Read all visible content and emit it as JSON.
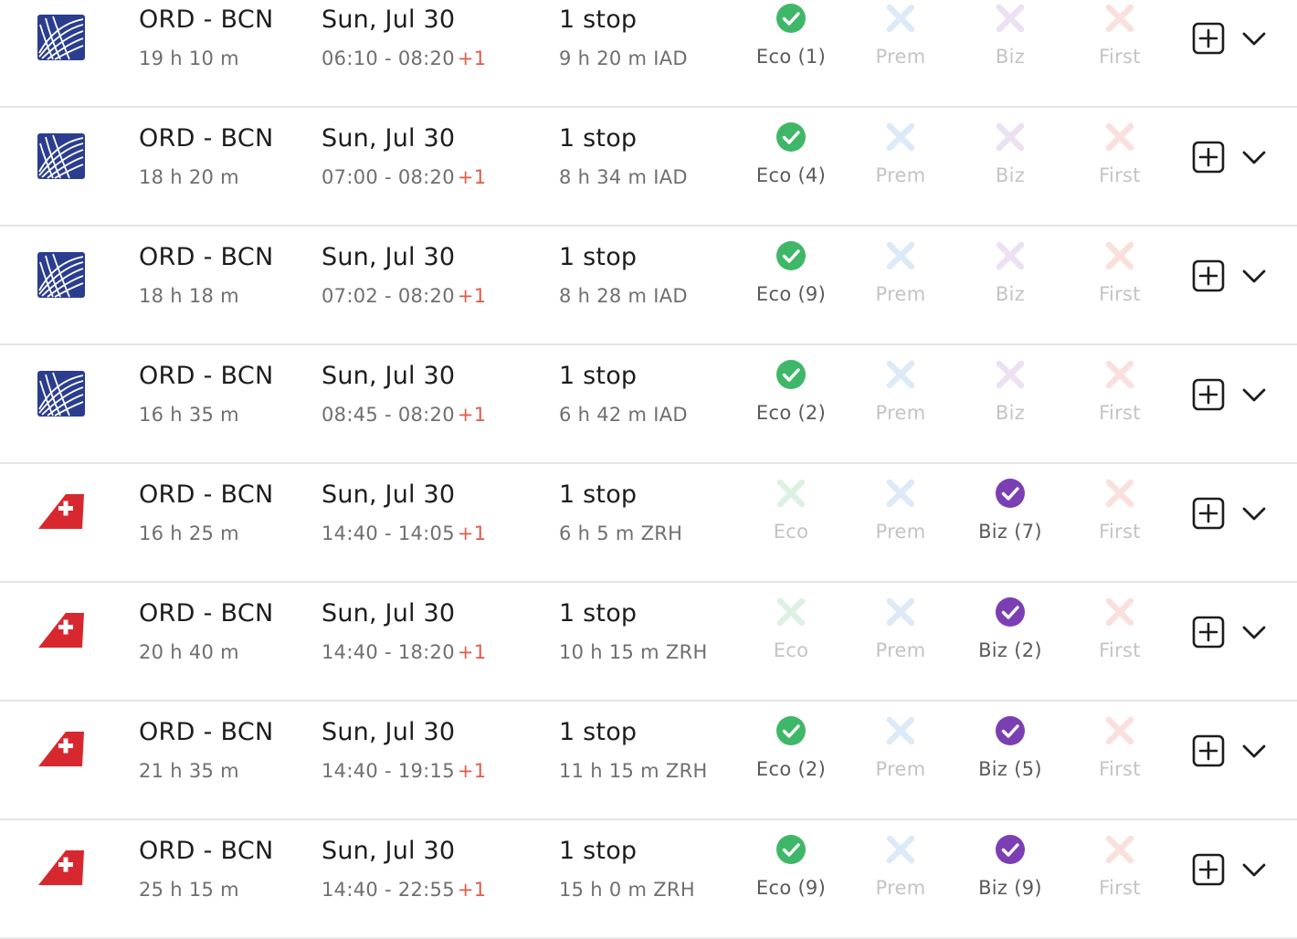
{
  "flights": [
    {
      "airline": "united",
      "route": "ORD - BCN",
      "duration": "19 h 10 m",
      "date": "Sun, Jul 30",
      "times": "06:10 - 08:20",
      "plus_day": "+1",
      "stops": "1 stop",
      "layover": "9 h 20 m  IAD",
      "cabins": [
        {
          "label": "Eco (1)",
          "available": true
        },
        {
          "label": "Prem",
          "available": false
        },
        {
          "label": "Biz",
          "available": false
        },
        {
          "label": "First",
          "available": false
        }
      ]
    },
    {
      "airline": "united",
      "route": "ORD - BCN",
      "duration": "18 h 20 m",
      "date": "Sun, Jul 30",
      "times": "07:00 - 08:20",
      "plus_day": "+1",
      "stops": "1 stop",
      "layover": "8 h 34 m  IAD",
      "cabins": [
        {
          "label": "Eco (4)",
          "available": true
        },
        {
          "label": "Prem",
          "available": false
        },
        {
          "label": "Biz",
          "available": false
        },
        {
          "label": "First",
          "available": false
        }
      ]
    },
    {
      "airline": "united",
      "route": "ORD - BCN",
      "duration": "18 h 18 m",
      "date": "Sun, Jul 30",
      "times": "07:02 - 08:20",
      "plus_day": "+1",
      "stops": "1 stop",
      "layover": "8 h 28 m  IAD",
      "cabins": [
        {
          "label": "Eco (9)",
          "available": true
        },
        {
          "label": "Prem",
          "available": false
        },
        {
          "label": "Biz",
          "available": false
        },
        {
          "label": "First",
          "available": false
        }
      ]
    },
    {
      "airline": "united",
      "route": "ORD - BCN",
      "duration": "16 h 35 m",
      "date": "Sun, Jul 30",
      "times": "08:45 - 08:20",
      "plus_day": "+1",
      "stops": "1 stop",
      "layover": "6 h 42 m  IAD",
      "cabins": [
        {
          "label": "Eco (2)",
          "available": true
        },
        {
          "label": "Prem",
          "available": false
        },
        {
          "label": "Biz",
          "available": false
        },
        {
          "label": "First",
          "available": false
        }
      ]
    },
    {
      "airline": "swiss",
      "route": "ORD - BCN",
      "duration": "16 h 25 m",
      "date": "Sun, Jul 30",
      "times": "14:40 - 14:05",
      "plus_day": "+1",
      "stops": "1 stop",
      "layover": "6 h 5 m  ZRH",
      "cabins": [
        {
          "label": "Eco",
          "available": false
        },
        {
          "label": "Prem",
          "available": false
        },
        {
          "label": "Biz (7)",
          "available": true
        },
        {
          "label": "First",
          "available": false
        }
      ]
    },
    {
      "airline": "swiss",
      "route": "ORD - BCN",
      "duration": "20 h 40 m",
      "date": "Sun, Jul 30",
      "times": "14:40 - 18:20",
      "plus_day": "+1",
      "stops": "1 stop",
      "layover": "10 h 15 m  ZRH",
      "cabins": [
        {
          "label": "Eco",
          "available": false
        },
        {
          "label": "Prem",
          "available": false
        },
        {
          "label": "Biz (2)",
          "available": true
        },
        {
          "label": "First",
          "available": false
        }
      ]
    },
    {
      "airline": "swiss",
      "route": "ORD - BCN",
      "duration": "21 h 35 m",
      "date": "Sun, Jul 30",
      "times": "14:40 - 19:15",
      "plus_day": "+1",
      "stops": "1 stop",
      "layover": "11 h 15 m  ZRH",
      "cabins": [
        {
          "label": "Eco (2)",
          "available": true
        },
        {
          "label": "Prem",
          "available": false
        },
        {
          "label": "Biz (5)",
          "available": true
        },
        {
          "label": "First",
          "available": false
        }
      ]
    },
    {
      "airline": "swiss",
      "route": "ORD - BCN",
      "duration": "25 h 15 m",
      "date": "Sun, Jul 30",
      "times": "14:40 - 22:55",
      "plus_day": "+1",
      "stops": "1 stop",
      "layover": "15 h 0 m  ZRH",
      "cabins": [
        {
          "label": "Eco (9)",
          "available": true
        },
        {
          "label": "Prem",
          "available": false
        },
        {
          "label": "Biz (9)",
          "available": true
        },
        {
          "label": "First",
          "available": false
        }
      ]
    }
  ],
  "cabin_classes": [
    {
      "key": "eco",
      "available_color": "#3fb768",
      "unavailable_color": "#ddf1e3",
      "available_icon": "check-circle-icon",
      "unavailable_icon": "x-icon"
    },
    {
      "key": "prem",
      "available_color": "#4a90d9",
      "unavailable_color": "#dce9f7",
      "available_icon": "check-circle-icon",
      "unavailable_icon": "x-icon"
    },
    {
      "key": "biz",
      "available_color": "#7b3fb3",
      "unavailable_color": "#ece0f3",
      "available_icon": "check-circle-icon",
      "unavailable_icon": "x-icon"
    },
    {
      "key": "first",
      "available_color": "#e25b4b",
      "unavailable_color": "#fae0dc",
      "available_icon": "check-circle-icon",
      "unavailable_icon": "x-icon"
    }
  ],
  "airlines": {
    "united": {
      "icon": "united-globe-icon",
      "color": "#2b3d8f"
    },
    "swiss": {
      "icon": "swiss-tail-icon",
      "color": "#d8282f"
    }
  },
  "colors": {
    "plus_day": "#e25b4b",
    "divider": "#e6e6e6"
  }
}
